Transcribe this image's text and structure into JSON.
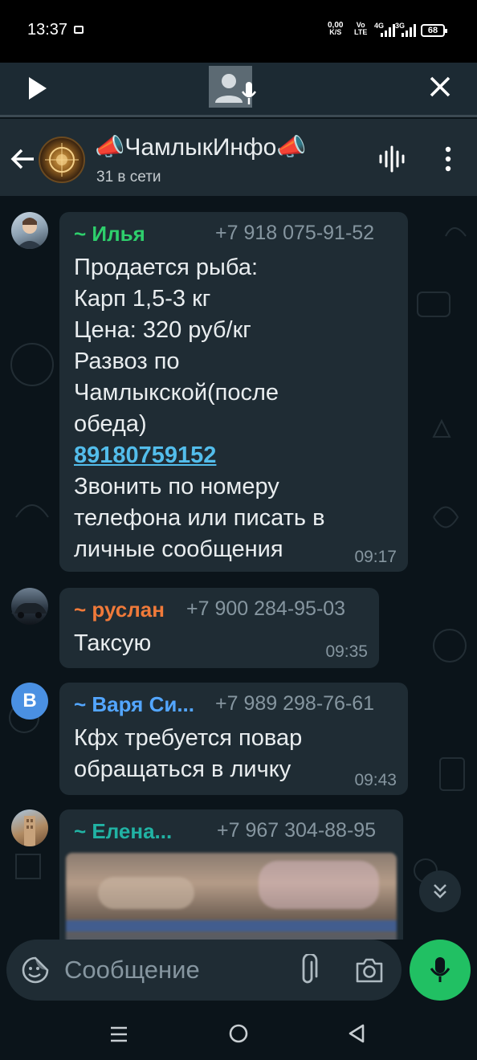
{
  "status_bar": {
    "time": "13:37",
    "net_speed_value": "0,00",
    "net_speed_unit": "K/S",
    "volte_top": "Vo",
    "volte_bottom": "LTE",
    "signal1_label": "4G",
    "signal2_label": "3G",
    "battery": "68"
  },
  "voice_bar": {
    "play_icon": "play-icon",
    "avatar_icon": "voice-user-mic-icon",
    "close_icon": "close-icon"
  },
  "header": {
    "title": "📣ЧамлыкИнфо📣",
    "subtitle": "31 в сети",
    "voice_chat_icon": "voice-chat-waveform-icon",
    "menu_icon": "more-vert-icon"
  },
  "messages": [
    {
      "name": "~ Илья",
      "name_color": "#2ecf6c",
      "phone": "+7 918 075-91-52",
      "lines_before": [
        "Продается рыба:",
        "Карп 1,5-3 кг",
        "Цена: 320 руб/кг",
        "Развоз по",
        "Чамлыкской(после",
        "обеда)"
      ],
      "link": "89180759152",
      "lines_after": [
        "Звонить по номеру",
        "телефона или писать в",
        "личные сообщения"
      ],
      "time": "09:17"
    },
    {
      "name": "~ руслан",
      "name_color": "#f07a3a",
      "phone": "+7 900 284-95-03",
      "lines": [
        "Таксую"
      ],
      "time": "09:35"
    },
    {
      "name": "~ Варя Си...",
      "name_color": "#53a6ff",
      "phone": "+7 989 298-76-61",
      "avatar_letter": "В",
      "lines": [
        "Кфх требуется повар",
        "обращаться в личку"
      ],
      "time": "09:43"
    },
    {
      "name": "~ Елена...",
      "name_color": "#21b3a4",
      "phone": "+7 967 304-88-95"
    }
  ],
  "composer": {
    "placeholder": "Сообщение",
    "emoji_icon": "emoji-sticker-icon",
    "attach_icon": "paperclip-icon",
    "camera_icon": "camera-icon",
    "mic_icon": "mic-icon"
  },
  "colors": {
    "chat_bg": "#0b141a",
    "bubble": "#1f2c34",
    "header": "#1f2c34",
    "accent_green": "#21c063",
    "link": "#53bdeb"
  }
}
